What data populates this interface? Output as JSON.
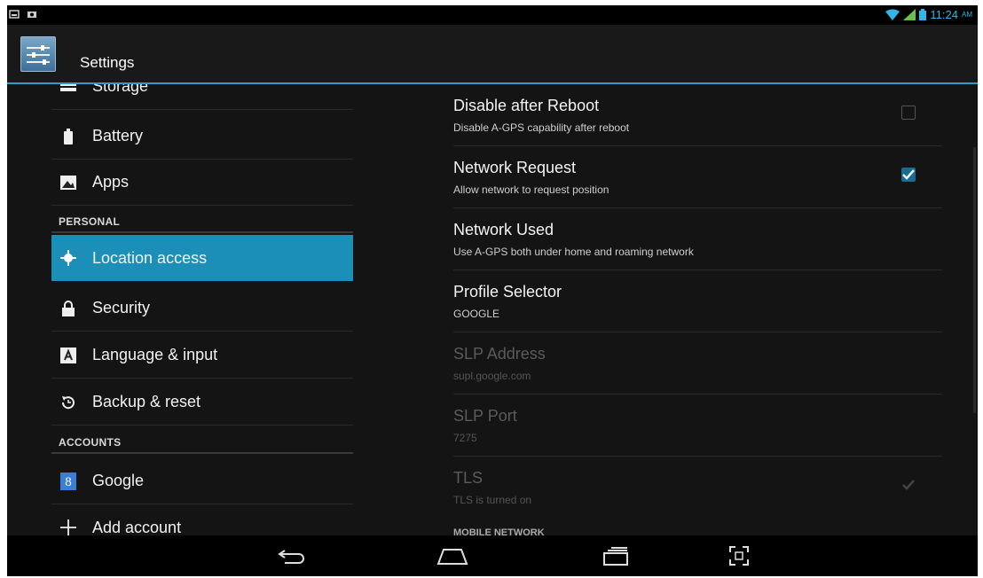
{
  "statusbar": {
    "time": "11:24",
    "ampm": "AM"
  },
  "actionbar": {
    "title": "Settings"
  },
  "sidebar": {
    "items_top": [
      {
        "label": "Storage",
        "icon": "storage-icon"
      },
      {
        "label": "Battery",
        "icon": "battery-icon"
      },
      {
        "label": "Apps",
        "icon": "apps-icon"
      }
    ],
    "personal_header": "PERSONAL",
    "items_personal": [
      {
        "label": "Location access",
        "icon": "location-icon",
        "active": true
      },
      {
        "label": "Security",
        "icon": "lock-icon"
      },
      {
        "label": "Language & input",
        "icon": "keyboard-icon"
      },
      {
        "label": "Backup & reset",
        "icon": "backup-icon"
      }
    ],
    "accounts_header": "ACCOUNTS",
    "items_accounts": [
      {
        "label": "Google",
        "icon": "google-icon"
      },
      {
        "label": "Add account",
        "icon": "add-icon"
      }
    ]
  },
  "prefs": [
    {
      "title": "Disable after Reboot",
      "summary": "Disable A-GPS capability after reboot",
      "checkbox": "unchecked",
      "enabled": true
    },
    {
      "title": "Network Request",
      "summary": "Allow network to request position",
      "checkbox": "checked",
      "enabled": true
    },
    {
      "title": "Network Used",
      "summary": "Use A-GPS both under home and roaming network",
      "enabled": true
    },
    {
      "title": "Profile Selector",
      "summary": "GOOGLE",
      "enabled": true
    },
    {
      "title": "SLP Address",
      "summary": "supl.google.com",
      "enabled": false
    },
    {
      "title": "SLP Port",
      "summary": "7275",
      "enabled": false
    },
    {
      "title": "TLS",
      "summary": "TLS is turned on",
      "checkbox": "checked",
      "enabled": false
    }
  ],
  "mobile_network_header": "MOBILE NETWORK",
  "colors": {
    "accent": "#33b5e5",
    "active_row": "#1c8fb9",
    "background": "#141414"
  }
}
